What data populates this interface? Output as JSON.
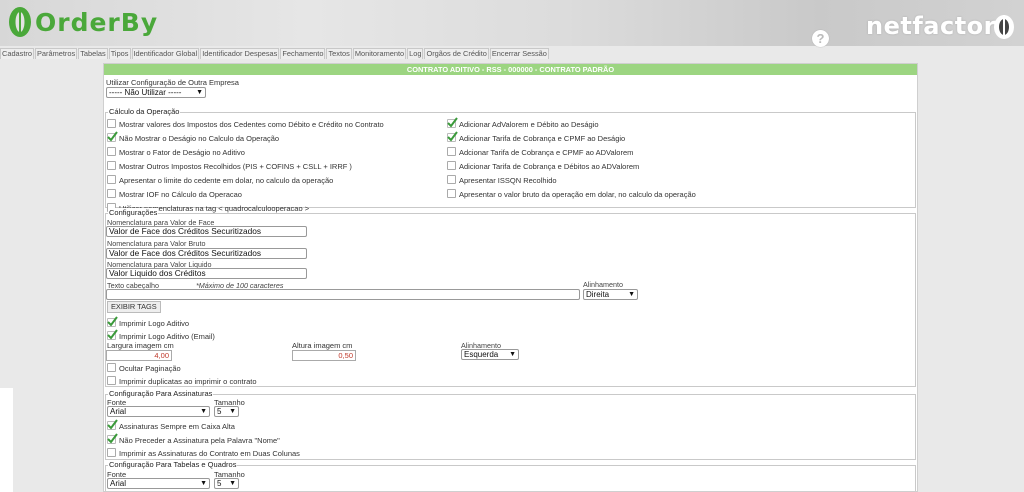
{
  "header": {
    "logo_text": "OrderBy",
    "help_label": "?",
    "brand_text": "netfactor",
    "brand_color": "#ffffff",
    "accent_green": "#4aa83a"
  },
  "menu": [
    "Cadastro",
    "Parâmetros",
    "Tabelas",
    "Tipos",
    "Identificador Global",
    "Identificador Despesas",
    "Fechamento",
    "Textos",
    "Monitoramento",
    "Log",
    "Orgãos de Crédito",
    "Encerrar Sessão"
  ],
  "page": {
    "title": "CONTRATO ADITIVO - RSS - 000000 - CONTRATO PADRÃO",
    "title_bg": "#9cd581",
    "outra_empresa_label": "Utilizar Configuração de Outra Empresa",
    "outra_empresa_value": "----- Não Utilizar -----"
  },
  "calculo": {
    "legend": "Cálculo da Operação",
    "left": [
      {
        "label": "Mostrar valores dos Impostos dos Cedentes como Débito e Crédito no Contrato",
        "checked": false
      },
      {
        "label": "Não Mostrar o Deságio no Calculo da Operação",
        "checked": true
      },
      {
        "label": "Mostrar o Fator de Deságio no Aditivo",
        "checked": false
      },
      {
        "label": "Mostrar Outros Impostos Recolhidos (PIS + COFINS + CSLL + IRRF )",
        "checked": false
      },
      {
        "label": "Apresentar o limite do cedente em dolar, no calculo da operação",
        "checked": false
      },
      {
        "label": "Mostrar IOF no Cálculo da Operacao",
        "checked": false
      },
      {
        "label": "Utilizar nomenclaturas na tag < quadrocalculooperacao >",
        "checked": false
      }
    ],
    "right": [
      {
        "label": "Adicionar AdValorem e Débito ao Deságio",
        "checked": true
      },
      {
        "label": "Adicionar Tarifa de Cobrança e CPMF ao Deságio",
        "checked": true
      },
      {
        "label": "Adcionar Tarifa de Cobrança e CPMF ao ADValorem",
        "checked": false
      },
      {
        "label": "Adicionar Tarifa de Cobrança e Débitos ao ADValorem",
        "checked": false
      },
      {
        "label": "Apresentar ISSQN Recolhido",
        "checked": false
      },
      {
        "label": "Apresentar o valor bruto da operação em dolar, no calculo da operação",
        "checked": false
      }
    ]
  },
  "configuracoes": {
    "legend": "Configurações",
    "nom_face_label": "Nomenclatura para Valor de Face",
    "nom_face_value": "Valor de Face dos Créditos Securitizados",
    "nom_bruto_label": "Nomenclatura para Valor Bruto",
    "nom_bruto_value": "Valor de Face dos Créditos Securitizados",
    "nom_liquido_label": "Nomenclatura para Valor Liquido",
    "nom_liquido_value": "Valor Liquido dos Créditos",
    "texto_cab_label": "Texto cabeçalho",
    "texto_cab_hint": "*Máximo de 100 caracteres",
    "texto_cab_value": "",
    "alinhamento_label": "Alinhamento",
    "alinhamento_value": "Direita",
    "exibir_tags": "EXIBIR TAGS",
    "imprimir_logo": "Imprimir Logo Aditivo",
    "imprimir_logo_email": "Imprimir Logo Aditivo (Email)",
    "largura_label": "Largura imagem cm",
    "largura_value": "4,00",
    "altura_label": "Altura imagem cm",
    "altura_value": "0,50",
    "alinhamento_img_label": "Alinhamento",
    "alinhamento_img_value": "Esquerda",
    "ocultar_paginacao": "Ocultar Paginação",
    "imprimir_duplicatas": "Imprimir duplicatas ao imprimir o contrato"
  },
  "assinaturas": {
    "legend": "Configuração Para Assinaturas",
    "fonte_label": "Fonte",
    "fonte_value": "Arial",
    "tamanho_label": "Tamanho",
    "tamanho_value": "5",
    "caixa_alta": "Assinaturas Sempre em Caixa Alta",
    "nao_preceder": "Não Preceder a Assinatura pela Palavra \"Nome\"",
    "duas_colunas": "Imprimir as Assinaturas do Contrato em Duas Colunas"
  },
  "tabelas": {
    "legend": "Configuração Para Tabelas e Quadros",
    "fonte_label": "Fonte",
    "fonte_value": "Arial",
    "tamanho_label": "Tamanho",
    "tamanho_value": "5"
  }
}
